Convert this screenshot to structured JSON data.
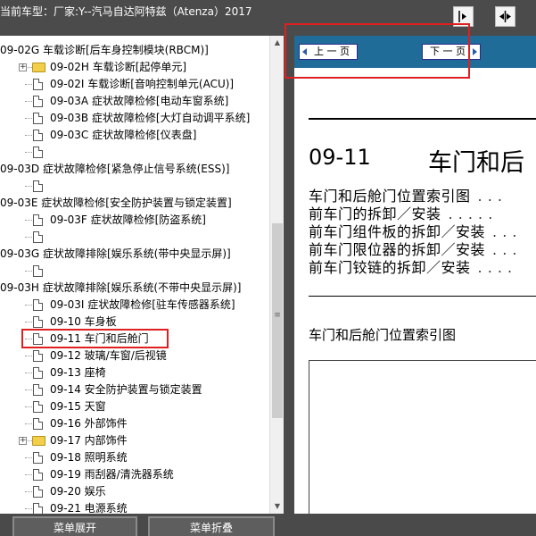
{
  "header": {
    "title": "当前车型：厂家:Y--汽马自达阿特兹（Atenza）2017",
    "btn1_icon": "arrow-bracket-icon",
    "btn2_icon": "double-arrow-icon"
  },
  "tree": {
    "items": [
      {
        "label": "09-02G 车载诊断[后车身控制模块(RBCM)]",
        "type": "text",
        "indent": 0
      },
      {
        "label": "09-02H 车载诊断[起停单元]",
        "type": "folder",
        "indent": 1
      },
      {
        "label": "09-02I 车载诊断[音响控制单元(ACU)]",
        "type": "doc",
        "indent": 1
      },
      {
        "label": "09-03A 症状故障检修[电动车窗系统]",
        "type": "doc",
        "indent": 1
      },
      {
        "label": "09-03B 症状故障检修[大灯自动调平系统]",
        "type": "doc",
        "indent": 1
      },
      {
        "label": "09-03C 症状故障检修[仪表盘]",
        "type": "doc",
        "indent": 1
      },
      {
        "label": "",
        "type": "doc",
        "indent": 1
      },
      {
        "label": "09-03D 症状故障检修[紧急停止信号系统(ESS)]",
        "type": "text",
        "indent": 0
      },
      {
        "label": "",
        "type": "doc",
        "indent": 1
      },
      {
        "label": "09-03E 症状故障检修[安全防护装置与锁定装置]",
        "type": "text",
        "indent": 0
      },
      {
        "label": "09-03F 症状故障检修[防盗系统]",
        "type": "doc",
        "indent": 1
      },
      {
        "label": "",
        "type": "doc",
        "indent": 1
      },
      {
        "label": "09-03G 症状故障排除[娱乐系统(带中央显示屏)]",
        "type": "text",
        "indent": 0
      },
      {
        "label": "",
        "type": "doc",
        "indent": 1
      },
      {
        "label": "09-03H 症状故障排除[娱乐系统(不带中央显示屏)]",
        "type": "text",
        "indent": 0
      },
      {
        "label": "09-03I 症状故障检修[驻车传感器系统]",
        "type": "doc",
        "indent": 1
      },
      {
        "label": "09-10 车身板",
        "type": "doc",
        "indent": 1
      },
      {
        "label": "09-11 车门和后舱门",
        "type": "doc",
        "indent": 1,
        "selected": true
      },
      {
        "label": "09-12 玻璃/车窗/后视镜",
        "type": "doc",
        "indent": 1
      },
      {
        "label": "09-13 座椅",
        "type": "doc",
        "indent": 1
      },
      {
        "label": "09-14 安全防护装置与锁定装置",
        "type": "doc",
        "indent": 1
      },
      {
        "label": "09-15 天窗",
        "type": "doc",
        "indent": 1
      },
      {
        "label": "09-16 外部饰件",
        "type": "doc",
        "indent": 1
      },
      {
        "label": "09-17 内部饰件",
        "type": "folder",
        "indent": 1
      },
      {
        "label": "09-18 照明系统",
        "type": "doc",
        "indent": 1
      },
      {
        "label": "09-19 雨刮器/清洗器系统",
        "type": "doc",
        "indent": 1
      },
      {
        "label": "09-20 娱乐",
        "type": "doc",
        "indent": 1
      },
      {
        "label": "09-21 电源系统",
        "type": "doc",
        "indent": 1
      }
    ]
  },
  "scroll": {
    "up_icon": "scroll-up-icon",
    "down_icon": "scroll-down-icon",
    "grip": "≡"
  },
  "doc": {
    "prev_label": "上 一 页",
    "next_label": "下 一 页",
    "chapter_number": "09-11",
    "chapter_title": "车门和后",
    "toc": [
      {
        "text": "车门和后舱门位置索引图",
        "dots": ". . ."
      },
      {
        "text": "前车门的拆卸／安装",
        "dots": ". . . . ."
      },
      {
        "text": "前车门组件板的拆卸／安装",
        "dots": ". . ."
      },
      {
        "text": "前车门限位器的拆卸／安装",
        "dots": ". . ."
      },
      {
        "text": "前车门铰链的拆卸／安装",
        "dots": ". . . ."
      }
    ],
    "section_title": "车门和后舱门位置索引图"
  },
  "bottom": {
    "expand_label": "菜单展开",
    "collapse_label": "菜单折叠"
  },
  "colors": {
    "nav_bar": "#1f6c98",
    "highlight": "#e02020",
    "folder": "#f2cf4a"
  }
}
